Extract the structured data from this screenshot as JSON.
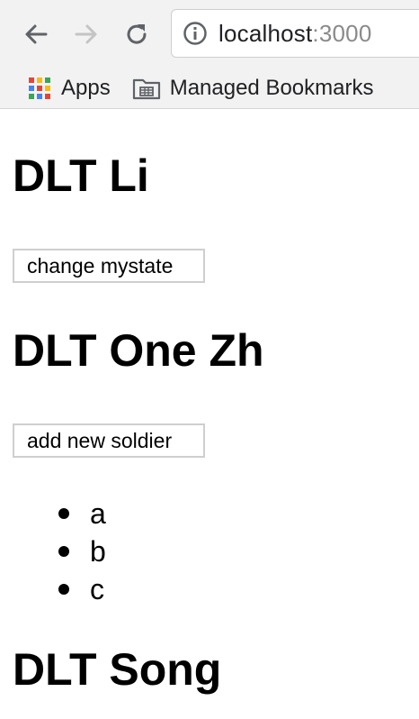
{
  "browser": {
    "url_host": "localhost",
    "url_port": ":3000",
    "nav": {
      "back_icon": "back-arrow-icon",
      "forward_icon": "forward-arrow-icon",
      "reload_icon": "reload-icon",
      "info_icon": "info-icon"
    },
    "bookmarks": {
      "apps_label": "Apps",
      "managed_label": "Managed Bookmarks",
      "apps_icon_colors": [
        "#ea4335",
        "#fbbc05",
        "#34a853",
        "#4285f4",
        "#ea4335",
        "#fbbc05",
        "#34a853",
        "#4285f4",
        "#ea4335"
      ],
      "folder_icon": "managed-folder-icon"
    }
  },
  "page": {
    "heading_1": "DLT Li",
    "button_1": "change mystate",
    "heading_2": "DLT One Zh",
    "button_2": "add new soldier",
    "soldiers": [
      "a",
      "b",
      "c"
    ],
    "heading_3": "DLT Song"
  }
}
